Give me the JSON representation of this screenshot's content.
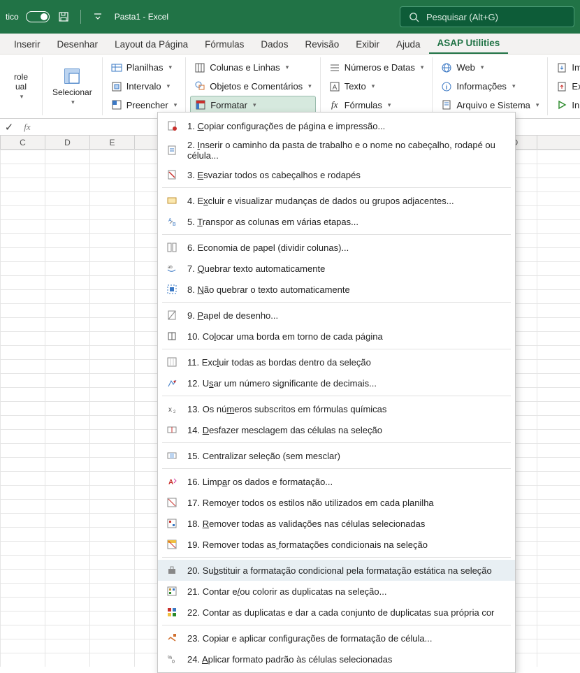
{
  "titlebar": {
    "toggle_label": "tico",
    "doc_title": "Pasta1  -  Excel",
    "search_placeholder": "Pesquisar (Alt+G)"
  },
  "tabs": {
    "inserir": "Inserir",
    "desenhar": "Desenhar",
    "layout": "Layout da Página",
    "formulas": "Fórmulas",
    "dados": "Dados",
    "revisao": "Revisão",
    "exibir": "Exibir",
    "ajuda": "Ajuda",
    "asap": "ASAP Utilities"
  },
  "ribbon": {
    "controle": "role\nual",
    "selecionar": "Selecionar",
    "planilhas": "Planilhas",
    "intervalo": "Intervalo",
    "preencher": "Preencher",
    "colunas_linhas": "Colunas e Linhas",
    "objetos": "Objetos e Comentários",
    "formatar": "Formatar",
    "numeros_datas": "Números e Datas",
    "texto": "Texto",
    "formulas": "Fórmulas",
    "web": "Web",
    "informacoes": "Informações",
    "arquivo_sistema": "Arquivo e Sistema",
    "importar": "Importar",
    "exportar": "Exportar",
    "iniciar": "Iniciar"
  },
  "columns": [
    "C",
    "D",
    "E",
    "",
    "",
    "",
    "",
    "",
    "",
    "",
    "",
    "O"
  ],
  "menu": {
    "items": [
      {
        "n": "1.",
        "t": "Copiar configurações de página e impressão...",
        "u": 0
      },
      {
        "n": "2.",
        "t": "Inserir o caminho da pasta de trabalho e o nome no cabeçalho, rodapé ou célula...",
        "u": 0
      },
      {
        "n": "3.",
        "t": "Esvaziar todos os cabeçalhos e rodapés",
        "u": 0
      },
      {
        "n": "4.",
        "t": "Excluir e visualizar mudanças de dados ou grupos adjacentes...",
        "u": 1
      },
      {
        "n": "5.",
        "t": "Transpor as colunas em várias etapas...",
        "u": 0
      },
      {
        "n": "6.",
        "t": "Economia de papel (dividir colunas)...",
        "u": -1
      },
      {
        "n": "7.",
        "t": "Quebrar texto automaticamente",
        "u": 0
      },
      {
        "n": "8.",
        "t": "Não quebrar o texto automaticamente",
        "u": 0
      },
      {
        "n": "9.",
        "t": "Papel de desenho...",
        "u": 0
      },
      {
        "n": "10.",
        "t": "Colocar uma borda em torno de cada página",
        "u": 2
      },
      {
        "n": "11.",
        "t": "Excluir todas as bordas dentro da seleção",
        "u": 3
      },
      {
        "n": "12.",
        "t": "Usar um número significante de decimais...",
        "u": 1
      },
      {
        "n": "13.",
        "t": "Os números subscritos em fórmulas químicas",
        "u": 5
      },
      {
        "n": "14.",
        "t": "Desfazer mesclagem das células na seleção",
        "u": 0
      },
      {
        "n": "15.",
        "t": "Centralizar seleção (sem mesclar)",
        "u": -1
      },
      {
        "n": "16.",
        "t": "Limpar os dados e formatação...",
        "u": 4
      },
      {
        "n": "17.",
        "t": "Remover todos os estilos não utilizados em cada planilha",
        "u": 4
      },
      {
        "n": "18.",
        "t": "Remover todas as validações nas células selecionadas",
        "u": 0
      },
      {
        "n": "19.",
        "t": "Remover todas as formatações condicionais na seleção",
        "u": 16
      },
      {
        "n": "20.",
        "t": "Substituir a formatação condicional pela formatação estática na seleção",
        "u": 2
      },
      {
        "n": "21.",
        "t": "Contar e/ou colorir as duplicatas na seleção...",
        "u": 8
      },
      {
        "n": "22.",
        "t": "Contar as duplicatas e dar a cada conjunto de duplicatas sua própria cor",
        "u": -1
      },
      {
        "n": "23.",
        "t": "Copiar e aplicar configurações de formatação de célula...",
        "u": -1
      },
      {
        "n": "24.",
        "t": "Aplicar formato padrão às células selecionadas",
        "u": 0
      }
    ]
  }
}
